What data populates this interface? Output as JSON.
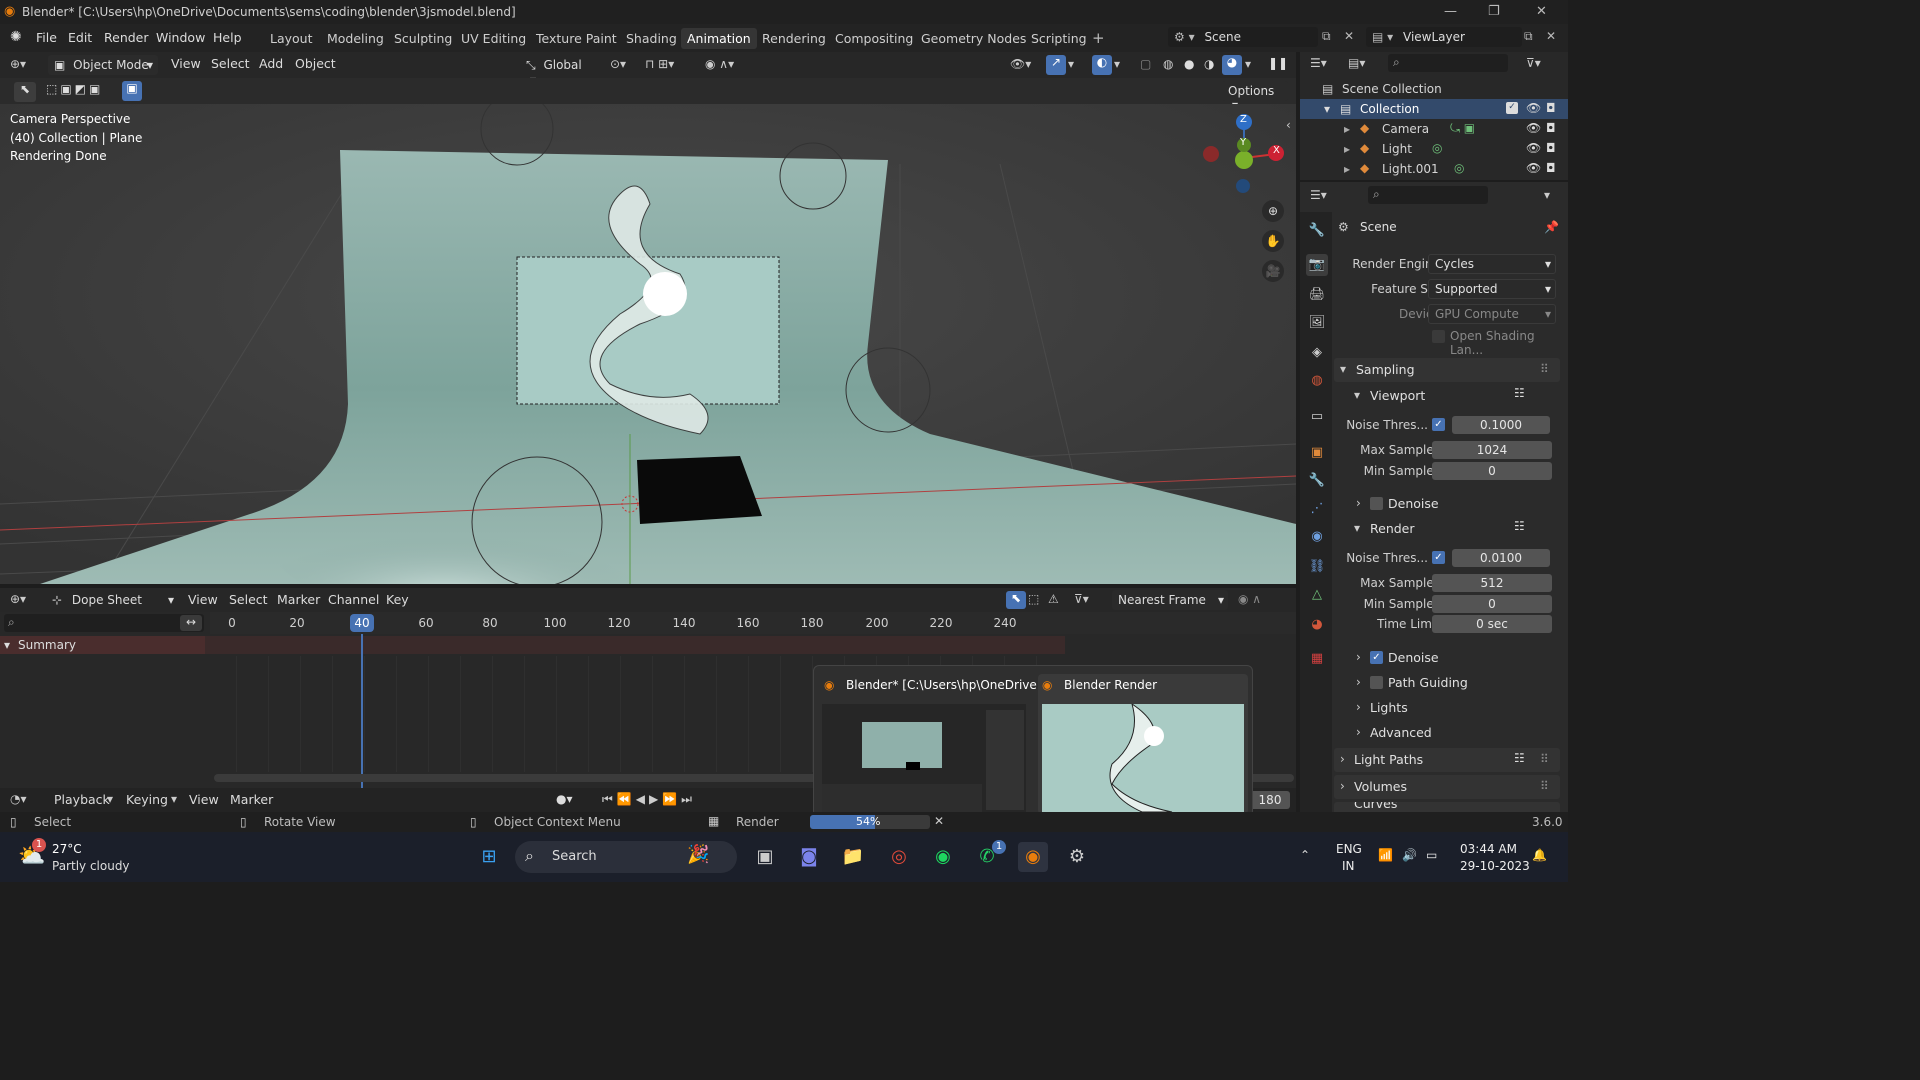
{
  "titlebar": {
    "title": "Blender* [C:\\Users\\hp\\OneDrive\\Documents\\sems\\coding\\blender\\3jsmodel.blend]"
  },
  "menu": {
    "items": [
      "File",
      "Edit",
      "Render",
      "Window",
      "Help"
    ]
  },
  "workspaces": [
    "Layout",
    "Modeling",
    "Sculpting",
    "UV Editing",
    "Texture Paint",
    "Shading",
    "Animation",
    "Rendering",
    "Compositing",
    "Geometry Nodes",
    "Scripting"
  ],
  "active_workspace": "Animation",
  "scene_selector": "Scene",
  "viewlayer_selector": "ViewLayer",
  "viewport_header": {
    "mode": "Object Mode",
    "menus": [
      "View",
      "Select",
      "Add",
      "Object"
    ],
    "orientation": "Global",
    "options_label": "Options"
  },
  "viewport_overlay": {
    "line1": "Camera Perspective",
    "line2": "(40) Collection | Plane",
    "line3": "Rendering Done"
  },
  "gizmo": {
    "z": "Z",
    "y": "Y",
    "x": "X"
  },
  "outliner": {
    "root": "Scene Collection",
    "collection": "Collection",
    "items": [
      {
        "label": "Camera"
      },
      {
        "label": "Light"
      },
      {
        "label": "Light.001"
      }
    ]
  },
  "properties": {
    "context": "Scene",
    "render_engine_label": "Render Engine",
    "render_engine": "Cycles",
    "feature_set_label": "Feature Set",
    "feature_set": "Supported",
    "device_label": "Device",
    "device": "GPU Compute",
    "osl_label": "Open Shading Lan...",
    "sampling": "Sampling",
    "viewport": "Viewport",
    "vp_noise_label": "Noise Thres...",
    "vp_noise": "0.1000",
    "vp_max_label": "Max Samples",
    "vp_max": "1024",
    "vp_min_label": "Min Samples",
    "vp_min": "0",
    "vp_denoise": "Denoise",
    "render": "Render",
    "r_noise_label": "Noise Thres...",
    "r_noise": "0.0100",
    "r_max_label": "Max Samples",
    "r_max": "512",
    "r_min_label": "Min Samples",
    "r_min": "0",
    "r_time_label": "Time Limit",
    "r_time": "0 sec",
    "r_denoise": "Denoise",
    "path_guiding": "Path Guiding",
    "lights": "Lights",
    "advanced": "Advanced",
    "light_paths": "Light Paths",
    "volumes": "Volumes",
    "curves": "Curves"
  },
  "dopesheet": {
    "editor": "Dope Sheet",
    "menus": [
      "View",
      "Select",
      "Marker",
      "Channel",
      "Key"
    ],
    "snap": "Nearest Frame",
    "summary": "Summary",
    "ticks": [
      "0",
      "20",
      "40",
      "60",
      "80",
      "100",
      "120",
      "140",
      "160",
      "180",
      "200",
      "220",
      "240"
    ],
    "current_frame": "40"
  },
  "timeline": {
    "menus": [
      "Playback",
      "Keying",
      "View",
      "Marker"
    ],
    "end_frame": "180"
  },
  "taskbar_preview": {
    "blender_title": "Blender* [C:\\Users\\hp\\OneDrive...",
    "render_title": "Blender Render"
  },
  "status": {
    "select": "Select",
    "rotate": "Rotate View",
    "context_menu": "Object Context Menu",
    "render": "Render",
    "progress": "54%",
    "progress_value": 54,
    "version": "3.6.0"
  },
  "taskbar": {
    "weather_temp": "27°C",
    "weather_desc": "Partly cloudy",
    "weather_badge": "1",
    "search": "Search",
    "whatsapp_badge": "1",
    "lang1": "ENG",
    "lang2": "IN",
    "time": "03:44 AM",
    "date": "29-10-2023"
  },
  "colors": {
    "accent": "#4772b3",
    "active_tab": "#353535",
    "ws_active": "#ffffff",
    "error_red": "#cc3333"
  }
}
